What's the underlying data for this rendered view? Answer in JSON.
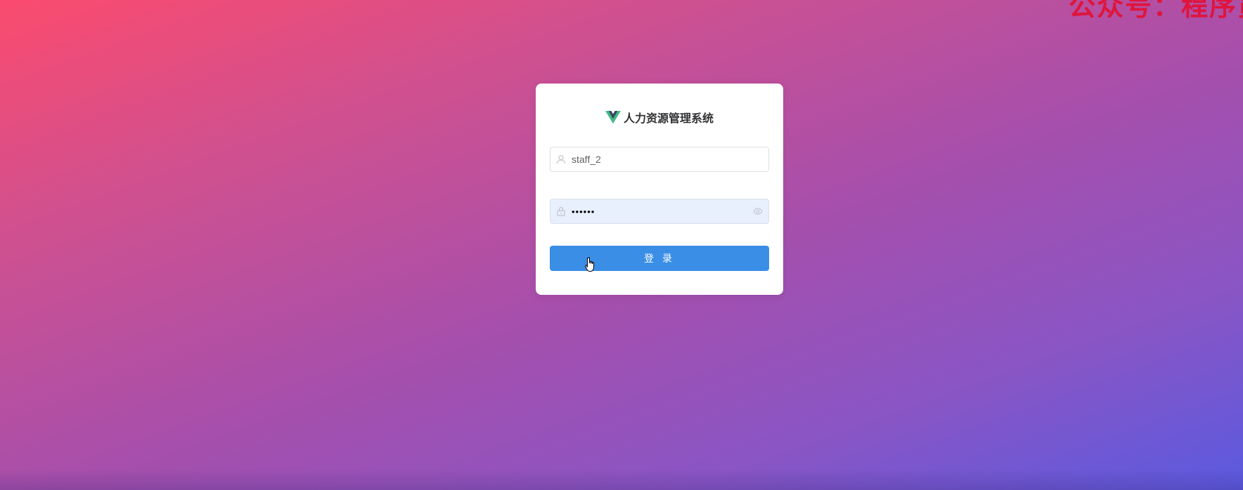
{
  "watermark": "公众号：程序员",
  "login": {
    "title": "人力资源管理系统",
    "username_value": "staff_2",
    "password_masked": "••••••",
    "submit_label": "登 录"
  },
  "icons": {
    "logo": "vue-logo-icon",
    "user": "user-icon",
    "lock": "lock-icon",
    "eye": "eye-icon",
    "cursor": "hand-pointer-cursor-icon"
  },
  "colors": {
    "primary": "#3a8ee6",
    "watermark": "#e0143c",
    "autofill_bg": "#e8f0fe"
  }
}
